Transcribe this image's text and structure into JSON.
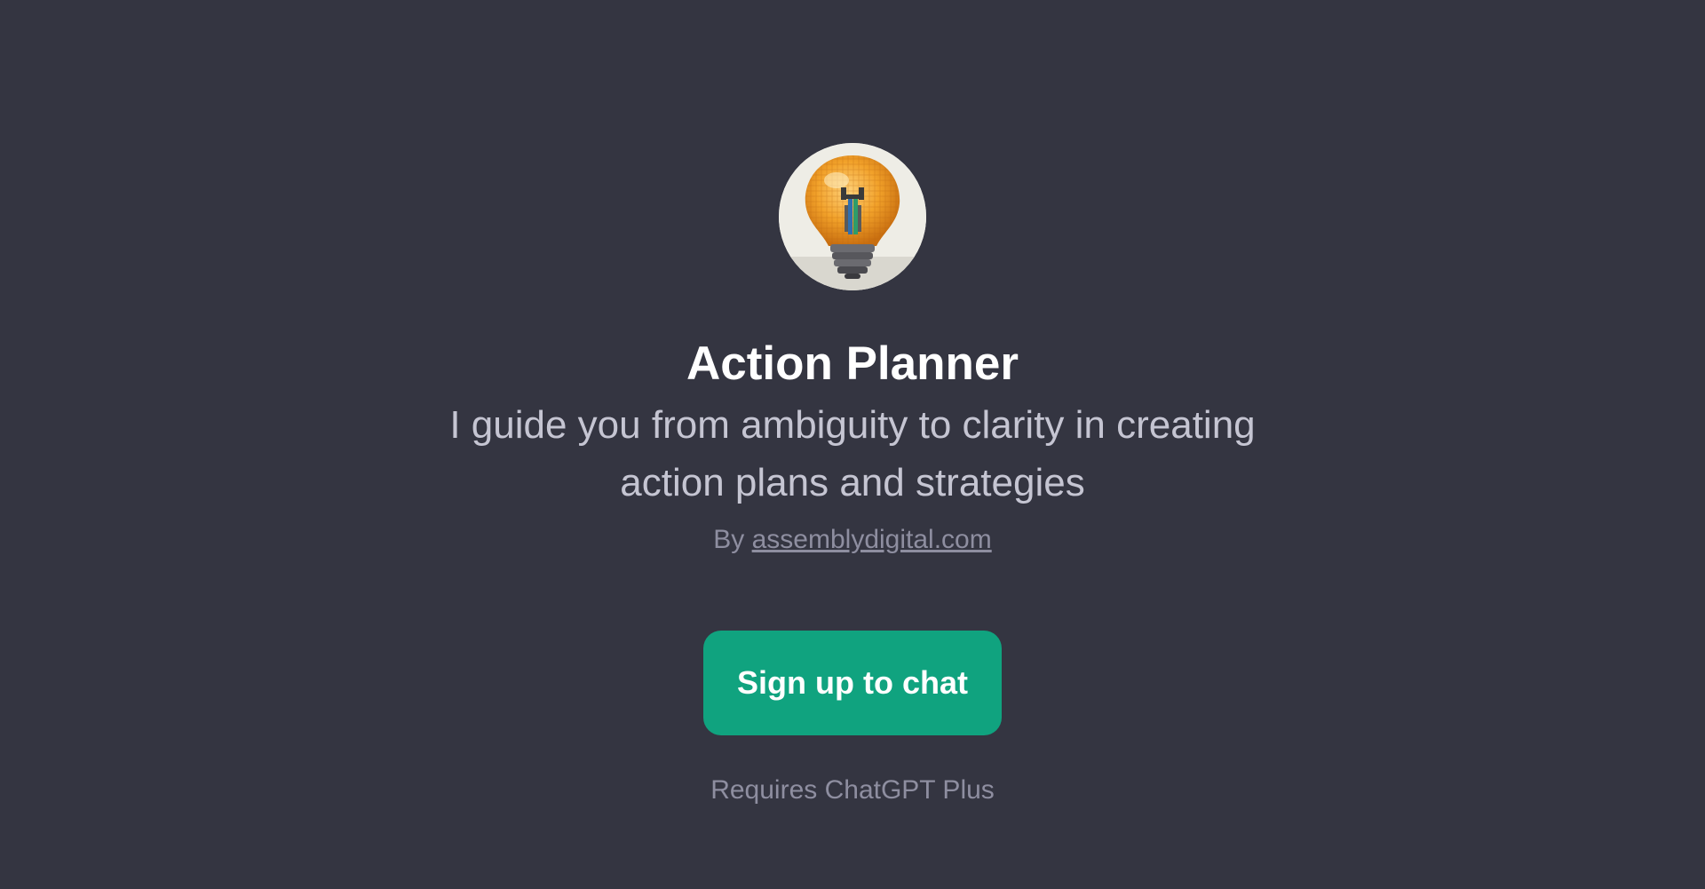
{
  "gpt": {
    "name": "Action Planner",
    "description": "I guide you from ambiguity to clarity in creating action plans and strategies",
    "by_prefix": "By",
    "author_link": "assemblydigital.com",
    "avatar_icon": "lightbulb-icon"
  },
  "cta": {
    "signup_label": "Sign up to chat",
    "requirement": "Requires ChatGPT Plus"
  },
  "colors": {
    "background": "#343541",
    "accent": "#10a37f",
    "title": "#ffffff",
    "description": "#c5c5d2",
    "muted": "#8e8ea0"
  }
}
